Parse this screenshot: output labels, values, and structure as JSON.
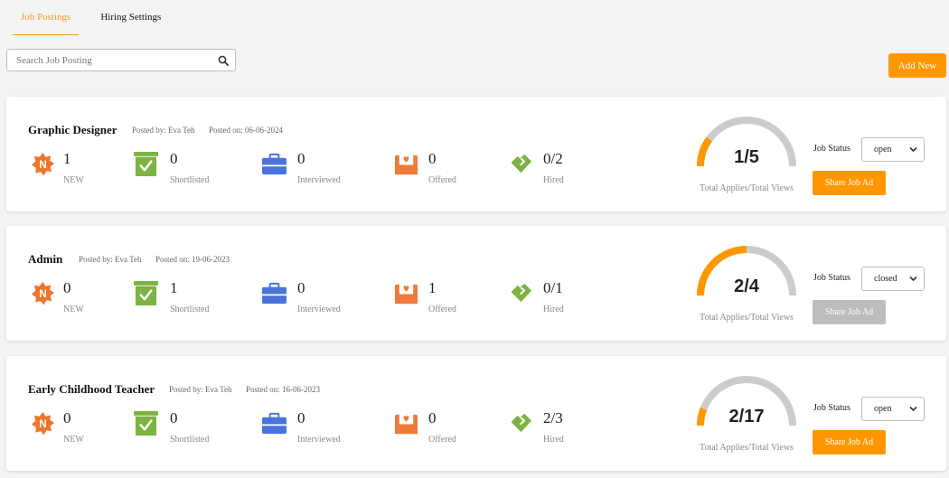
{
  "tabs": [
    {
      "label": "Job Postings",
      "active": true
    },
    {
      "label": "Hiring Settings",
      "active": false
    }
  ],
  "search": {
    "placeholder": "Search Job Posting",
    "icon": "search-icon"
  },
  "add_button": {
    "label": "Add New"
  },
  "colors": {
    "accent": "#ff9800",
    "gauge_track": "#cccccc",
    "new_icon": "#f0742d",
    "shortlist_icon": "#7cb342",
    "interview_icon": "#4a74db",
    "offered_icon": "#ef7a3a",
    "hired_icon": "#7cb342",
    "disabled_button": "#bdbdbd"
  },
  "jobs": [
    {
      "title": "Graphic Designer",
      "posted_by": "Posted by: Eva Teh",
      "posted_on": "Posted on: 06-06-2024",
      "stats": [
        {
          "value": "1",
          "label": "NEW",
          "icon": "new-badge-icon"
        },
        {
          "value": "0",
          "label": "Shortlisted",
          "icon": "shortlisted-icon"
        },
        {
          "value": "0",
          "label": "Interviewed",
          "icon": "briefcase-icon"
        },
        {
          "value": "0",
          "label": "Offered",
          "icon": "offer-envelope-icon"
        },
        {
          "value": "0/2",
          "label": "Hired",
          "icon": "handshake-icon"
        }
      ],
      "applies": 1,
      "views": 5,
      "ratio": "1/5",
      "gauge_label": "Total Applies/Total Views",
      "status_label": "Job Status",
      "status": "open",
      "share_label": "Share Job Ad",
      "share_enabled": true
    },
    {
      "title": "Admin",
      "posted_by": "Posted by: Eva Teh",
      "posted_on": "Posted on: 19-06-2023",
      "stats": [
        {
          "value": "0",
          "label": "NEW",
          "icon": "new-badge-icon"
        },
        {
          "value": "1",
          "label": "Shortlisted",
          "icon": "shortlisted-icon"
        },
        {
          "value": "0",
          "label": "Interviewed",
          "icon": "briefcase-icon"
        },
        {
          "value": "1",
          "label": "Offered",
          "icon": "offer-envelope-icon"
        },
        {
          "value": "0/1",
          "label": "Hired",
          "icon": "handshake-icon"
        }
      ],
      "applies": 2,
      "views": 4,
      "ratio": "2/4",
      "gauge_label": "Total Applies/Total Views",
      "status_label": "Job Status",
      "status": "closed",
      "share_label": "Share Job Ad",
      "share_enabled": false
    },
    {
      "title": "Early Childhood Teacher",
      "posted_by": "Posted by: Eva Teh",
      "posted_on": "Posted on: 16-06-2023",
      "stats": [
        {
          "value": "0",
          "label": "NEW",
          "icon": "new-badge-icon"
        },
        {
          "value": "0",
          "label": "Shortlisted",
          "icon": "shortlisted-icon"
        },
        {
          "value": "0",
          "label": "Interviewed",
          "icon": "briefcase-icon"
        },
        {
          "value": "0",
          "label": "Offered",
          "icon": "offer-envelope-icon"
        },
        {
          "value": "2/3",
          "label": "Hired",
          "icon": "handshake-icon"
        }
      ],
      "applies": 2,
      "views": 17,
      "ratio": "2/17",
      "gauge_label": "Total Applies/Total Views",
      "status_label": "Job Status",
      "status": "open",
      "share_label": "Share Job Ad",
      "share_enabled": true
    }
  ]
}
